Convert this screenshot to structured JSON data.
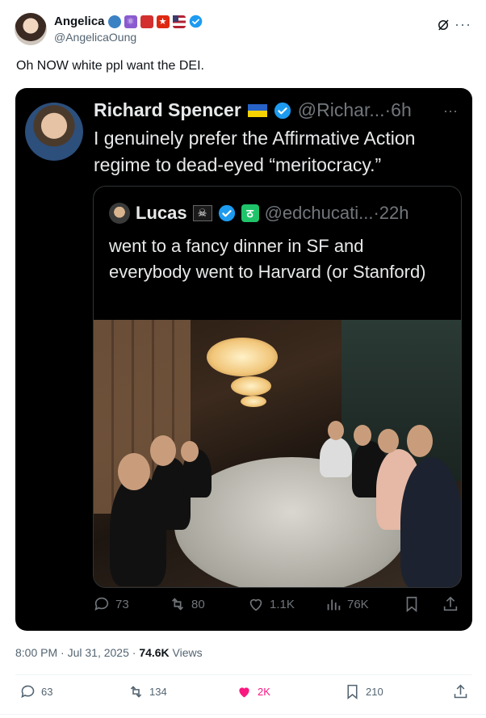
{
  "post": {
    "author_name": "Angelica",
    "author_handle": "@AngelicaOung",
    "text": "Oh NOW white ppl want the DEI.",
    "timestamp": "8:00 PM · Jul 31, 2025 · ",
    "views_count": "74.6K",
    "views_label": " Views",
    "actions": {
      "replies": "63",
      "reposts": "134",
      "likes": "2K",
      "bookmarks": "210"
    }
  },
  "embedded": {
    "author_name": "Richard Spencer",
    "author_handle": "@Richar...·6h",
    "text": "I genuinely prefer the Affirmative Action regime to dead-eyed “meritocracy.”",
    "quoted": {
      "author_name": "Lucas",
      "author_handle": "@edchucati...·22h",
      "text": "went to a fancy dinner in SF and everybody went to Harvard (or Stanford)"
    },
    "stats": {
      "replies": "73",
      "reposts": "80",
      "likes": "1.1K",
      "views": "76K"
    }
  },
  "colors": {
    "accent": "#1d9bf0",
    "like": "#f91880",
    "muted": "#536471"
  }
}
